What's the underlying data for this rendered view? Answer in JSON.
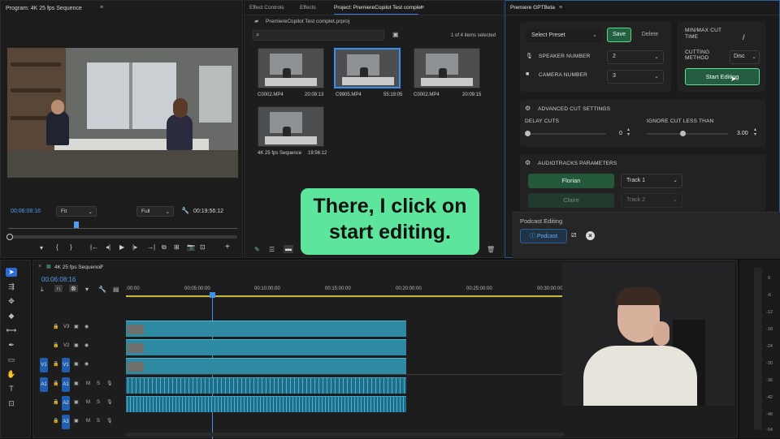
{
  "program": {
    "title": "Program: 4K 25 fps Sequence",
    "timecode_left": "00:06:08:16",
    "fit": "Fit",
    "full": "Full",
    "timecode_right": "00:19:56:12"
  },
  "center": {
    "tabs": [
      "Effect Controls",
      "Effects",
      "Project: PremiereCopilot Test complet"
    ],
    "project_file": "PremiereCopilot Test complet.prproj",
    "items_selected": "1 of 4 items selected",
    "clips": [
      {
        "name": "C0002.MP4",
        "duration": "20:09:13"
      },
      {
        "name": "C9905.MP4",
        "duration": "55:19:05"
      },
      {
        "name": "C0002.MP4",
        "duration": "20:09:15"
      },
      {
        "name": "4K 25 fps Sequence",
        "duration": "19:56:12"
      }
    ]
  },
  "gpt": {
    "title": "Premiere GPTBeta",
    "select_preset": "Select Preset",
    "save": "Save",
    "delete": "Delete",
    "minmax_label": "MIN/MAX CUT TIME",
    "minmax_value": "/",
    "speaker_label": "SPEAKER NUMBER",
    "speaker_value": "2",
    "camera_label": "CAMERA NUMBER",
    "camera_value": "3",
    "cutting_label": "CUTTING METHOD",
    "cutting_value": "Disc",
    "start_editing": "Start Editing",
    "advanced": "ADVANCED CUT SETTINGS",
    "delay_cuts": "DELAY CUTS",
    "delay_value": "0",
    "ignore_cut": "IGNORE CUT LESS THAN",
    "ignore_value": "3.00",
    "audiotracks": "AUDIOTRACKS PARAMETERS",
    "speaker1": "Florian",
    "track1": "Track 1",
    "speaker2": "Claire",
    "track2": "Track 2",
    "podcast_editing": "Podcast Editing",
    "podcast": "Podcast"
  },
  "caption": "There, I click on start editing.",
  "timeline": {
    "title": "4K 25 fps Sequence",
    "timecode": "00:06:08:16",
    "ruler": [
      ":00:00",
      "00:05:00:00",
      "00:10:00:00",
      "00:15:00:00",
      "00:20:00:00",
      "00:25:00:00",
      "00:30:00:00"
    ],
    "tracks": [
      {
        "src": "",
        "name": "V3"
      },
      {
        "src": "",
        "name": "V2"
      },
      {
        "src": "V1",
        "name": "V1"
      },
      {
        "src": "A1",
        "name": "A1",
        "m": "M",
        "s": "S"
      },
      {
        "src": "",
        "name": "A2",
        "m": "M",
        "s": "S"
      },
      {
        "src": "",
        "name": "A3",
        "m": "M",
        "s": "S"
      }
    ],
    "meter_ticks": [
      "0",
      "-6",
      "-12",
      "-18",
      "-24",
      "-30",
      "-36",
      "-42",
      "-48",
      "-54"
    ]
  }
}
